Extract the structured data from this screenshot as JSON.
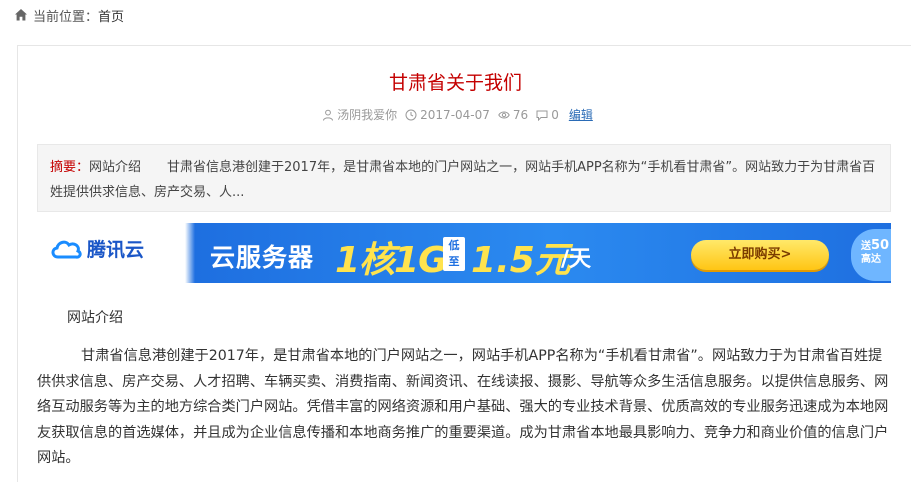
{
  "breadcrumb": {
    "prefix": "当前位置：",
    "home": "首页"
  },
  "article": {
    "title": "甘肃省关于我们",
    "author": "汤阴我爱你",
    "date": "2017-04-07",
    "views": "76",
    "comments": "0",
    "edit": "编辑"
  },
  "summary": {
    "label": "摘要：",
    "text": "网站介绍　　甘肃省信息港创建于2017年，是甘肃省本地的门户网站之一，网站手机APP名称为“手机看甘肃省”。网站致力于为甘肃省百姓提供供求信息、房产交易、人..."
  },
  "ad": {
    "brand": "腾讯云",
    "product": "云服务器",
    "spec": "1核1G",
    "badge_top": "低",
    "badge_bottom": "至",
    "price": "1.5元",
    "unit": "/天",
    "buy": "立即购买>",
    "corner_top": "送",
    "corner_mid": "50",
    "corner_bottom": "高达"
  },
  "content": {
    "section_title": "网站介绍",
    "paragraph": "甘肃省信息港创建于2017年，是甘肃省本地的门户网站之一，网站手机APP名称为“手机看甘肃省”。网站致力于为甘肃省百姓提供供求信息、房产交易、人才招聘、车辆买卖、消费指南、新闻资讯、在线读报、摄影、导航等众多生活信息服务。以提供信息服务、网络互动服务等为主的地方综合类门户网站。凭借丰富的网络资源和用户基础、强大的专业技术背景、优质高效的专业服务迅速成为本地网友获取信息的首选媒体，并且成为企业信息传播和本地商务推广的重要渠道。成为甘肃省本地最具影响力、竞争力和商业价值的信息门户网站。"
  },
  "colors": {
    "title": "#c40000",
    "link": "#2a6bb6",
    "ad_blue": "#1e6fe0",
    "ad_yellow": "#ffe34d"
  }
}
